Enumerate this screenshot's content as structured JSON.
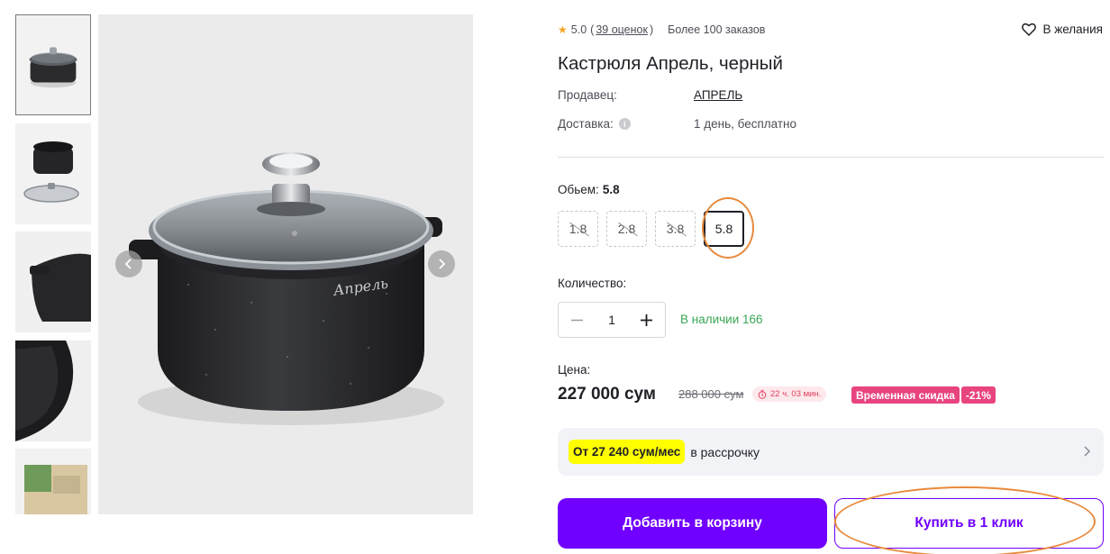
{
  "gallery": {
    "thumbnails": [
      "pot-with-lid",
      "pot-and-glass-lid",
      "pot-rim-closeup",
      "pot-interior-closeup",
      "product-box"
    ],
    "prev_icon": "chevron-left-icon",
    "next_icon": "chevron-right-icon",
    "brand_on_pot": "Апрель"
  },
  "product": {
    "rating": "5.0",
    "reviews_open": "(",
    "reviews": "39 оценок",
    "reviews_close": ")",
    "orders": "Более 100 заказов",
    "wishlist_label": "В желания",
    "title": "Кастрюля Апрель, черный",
    "seller_label": "Продавец:",
    "seller": "АПРЕЛЬ",
    "delivery_label": "Доставка:",
    "delivery_icon": "i",
    "delivery": "1 день, бесплатно"
  },
  "volume": {
    "label": "Обьем:",
    "selected": "5.8",
    "options": [
      {
        "value": "1.8",
        "available": false
      },
      {
        "value": "2.8",
        "available": false
      },
      {
        "value": "3.8",
        "available": false
      },
      {
        "value": "5.8",
        "available": true
      }
    ]
  },
  "quantity": {
    "label": "Количество:",
    "value": "1",
    "stock": "В наличии 166"
  },
  "pricing": {
    "label": "Цена:",
    "price": "227 000 сум",
    "old_price": "288 000 сум",
    "timer": "22 ч. 03 мин.",
    "promo_label": "Временная скидка",
    "discount": "-21%"
  },
  "installment": {
    "highlight": "От 27 240 сум/мес",
    "text": "в рассрочку"
  },
  "actions": {
    "add_to_cart": "Добавить в корзину",
    "buy_one_click": "Купить в 1 клик"
  },
  "colors": {
    "accent": "#7000ff",
    "stock_green": "#3aa655",
    "promo_pink": "#e8447f",
    "highlight_yellow": "#ffff00",
    "annotation_orange": "#e88a3c"
  }
}
